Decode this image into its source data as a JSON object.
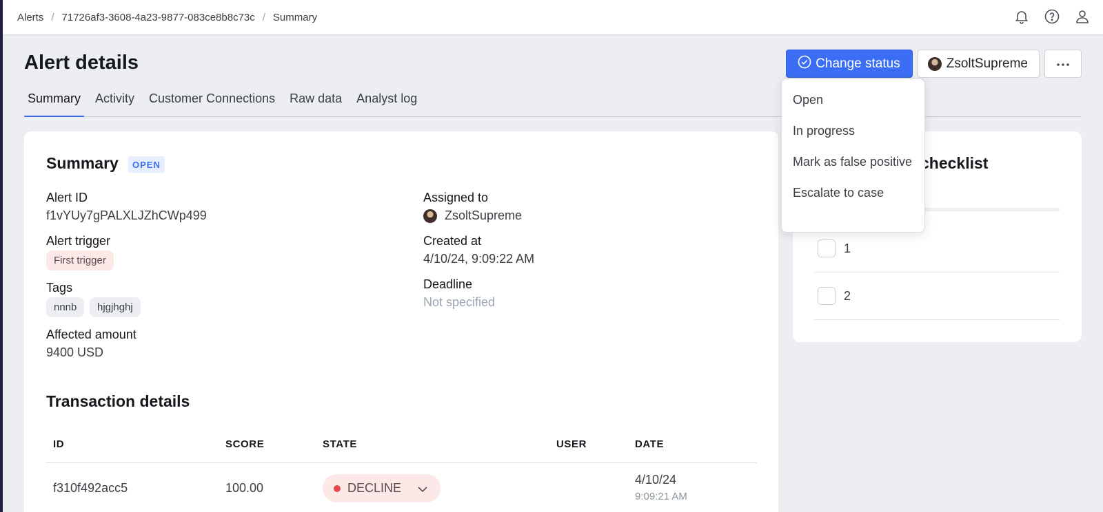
{
  "breadcrumb": [
    "Alerts",
    "71726af3-3608-4a23-9877-083ce8b8c73c",
    "Summary"
  ],
  "header": {
    "title": "Alert details",
    "change_status_label": "Change status",
    "assignee_button_label": "ZsoltSupreme",
    "more_icon": "ellipsis-icon"
  },
  "top_icons": [
    "bell-icon",
    "help-icon",
    "user-icon"
  ],
  "tabs": [
    {
      "label": "Summary",
      "active": true
    },
    {
      "label": "Activity"
    },
    {
      "label": "Customer Connections"
    },
    {
      "label": "Raw data"
    },
    {
      "label": "Analyst log"
    }
  ],
  "summary": {
    "title": "Summary",
    "status_badge": "OPEN",
    "alert_id_label": "Alert ID",
    "alert_id": "f1vYUy7gPALXLJZhCWp499",
    "trigger_label": "Alert trigger",
    "trigger": "First trigger",
    "tags_label": "Tags",
    "tags": [
      "nnnb",
      "hjgjhghj"
    ],
    "amount_label": "Affected amount",
    "amount": "9400 USD",
    "assigned_label": "Assigned to",
    "assigned": "ZsoltSupreme",
    "created_label": "Created at",
    "created": "4/10/24, 9:09:22 AM",
    "deadline_label": "Deadline",
    "deadline": "Not specified"
  },
  "transactions": {
    "title": "Transaction details",
    "columns": [
      "ID",
      "SCORE",
      "STATE",
      "USER",
      "DATE"
    ],
    "rows": [
      {
        "id": "f310f492acc5",
        "score": "100.00",
        "state": "DECLINE",
        "user": "",
        "date": "4/10/24",
        "time": "9:09:21 AM"
      }
    ]
  },
  "checklist": {
    "title_visible": "checklist",
    "items": [
      "1",
      "2"
    ]
  },
  "status_menu": {
    "items": [
      "Open",
      "In progress",
      "Mark as false positive",
      "Escalate to case"
    ]
  },
  "colors": {
    "primary": "#3b6ef5",
    "decline": "#e5484d",
    "open_badge_bg": "#e6eeff"
  }
}
